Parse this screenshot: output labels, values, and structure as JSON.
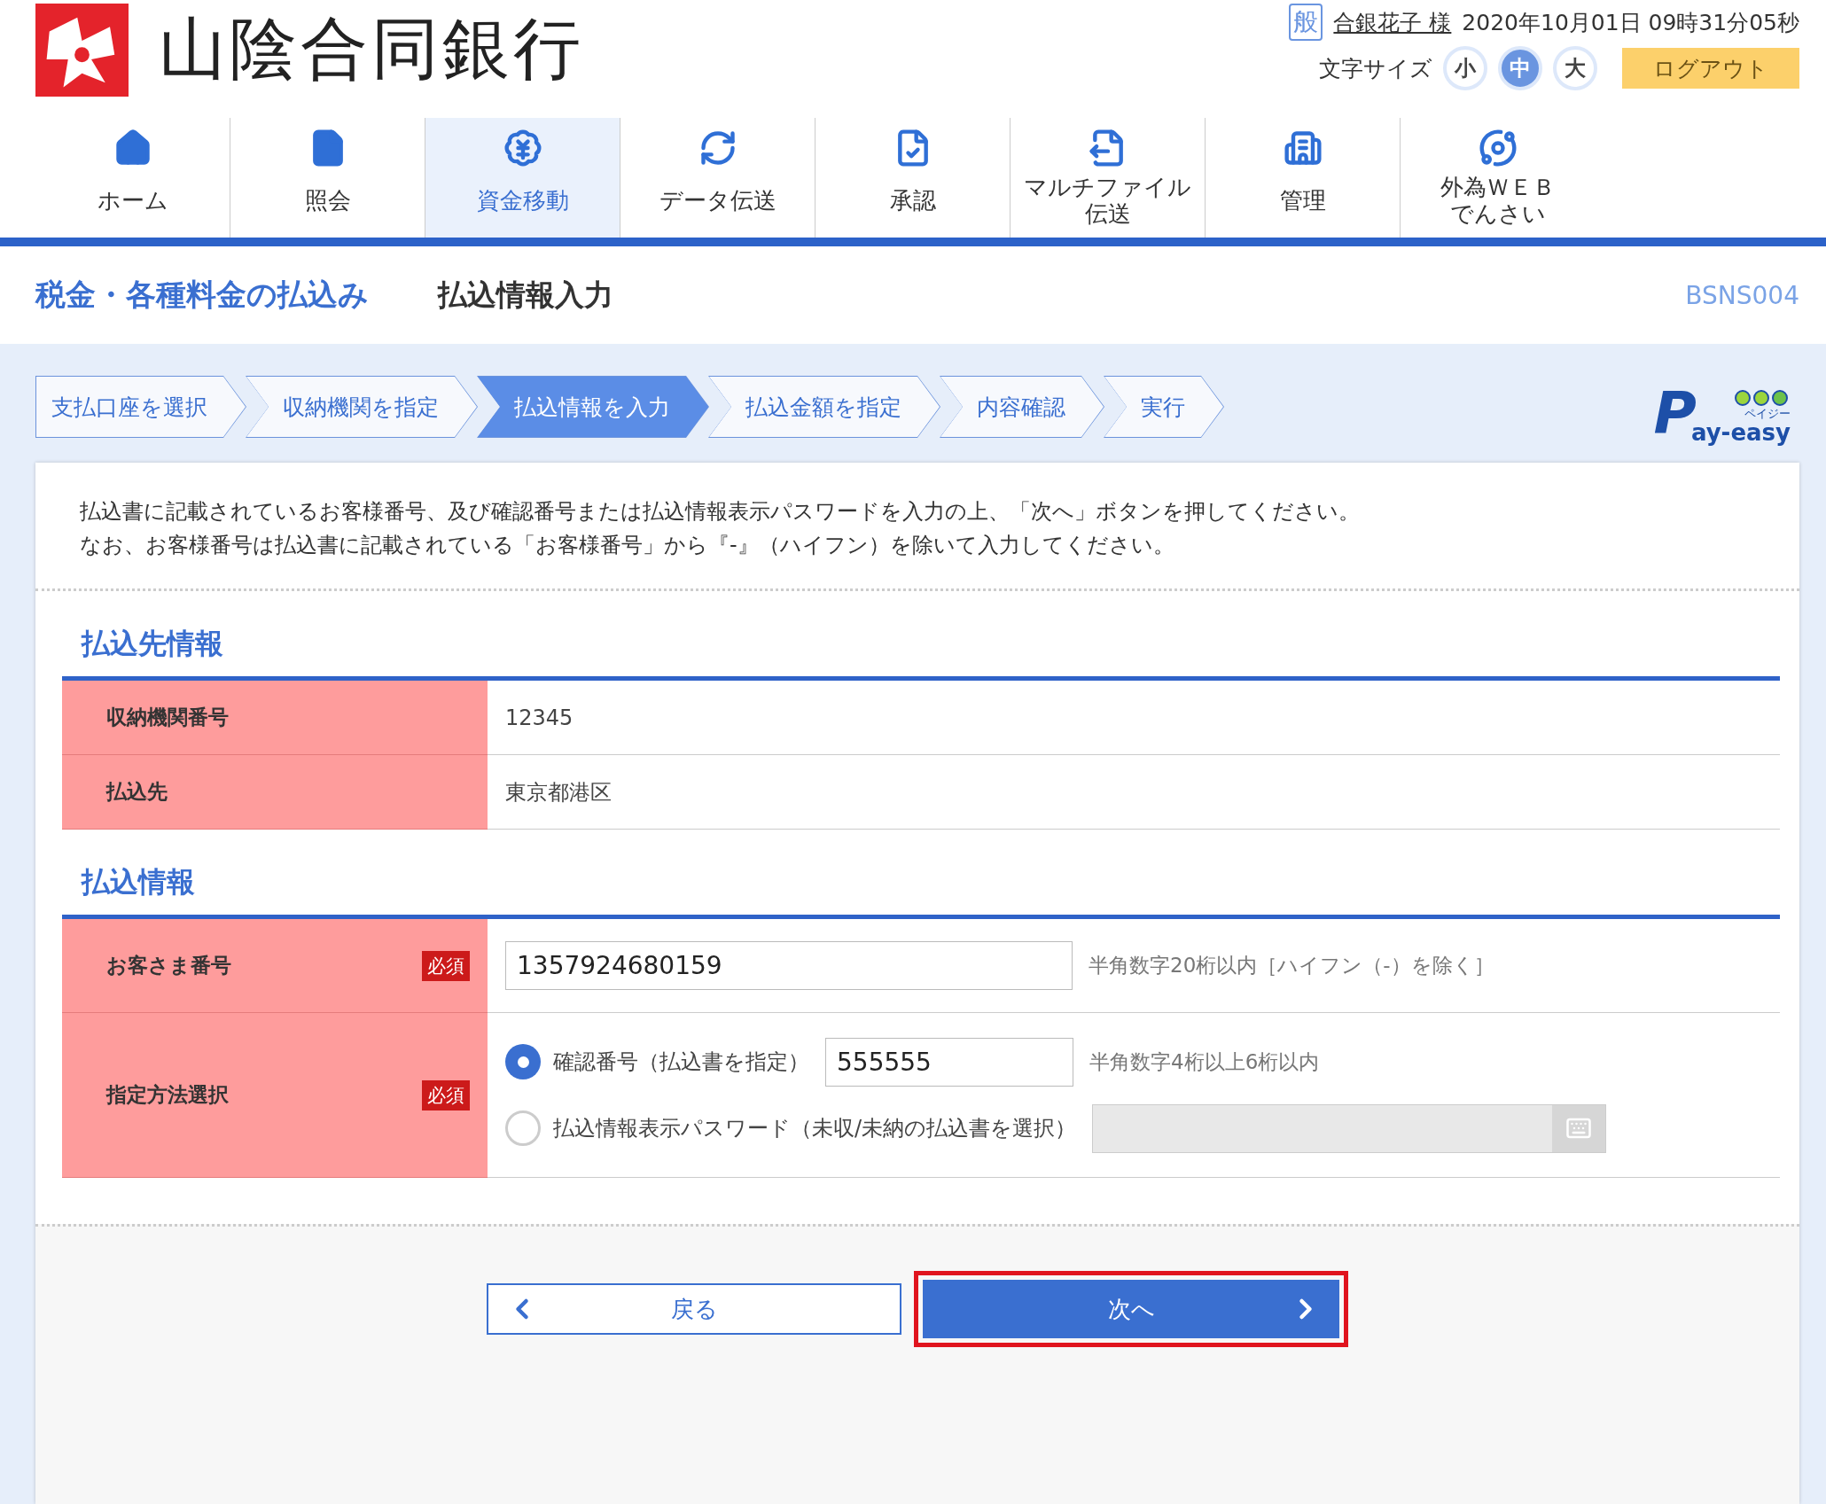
{
  "header": {
    "bank_name": "山陰合同銀行",
    "user_badge": "般",
    "user_name": "合銀花子 様",
    "datetime": "2020年10月01日 09時31分05秒",
    "font_size_label": "文字サイズ",
    "font_sizes": [
      {
        "label": "小",
        "selected": false
      },
      {
        "label": "中",
        "selected": true
      },
      {
        "label": "大",
        "selected": false
      }
    ],
    "logout": "ログアウト"
  },
  "nav": [
    {
      "lines": [
        "ホーム"
      ],
      "selected": false
    },
    {
      "lines": [
        "照会"
      ],
      "selected": false
    },
    {
      "lines": [
        "資金移動"
      ],
      "selected": true
    },
    {
      "lines": [
        "データ伝送"
      ],
      "selected": false
    },
    {
      "lines": [
        "承認"
      ],
      "selected": false
    },
    {
      "lines": [
        "マルチファイル",
        "伝送"
      ],
      "selected": false
    },
    {
      "lines": [
        "管理"
      ],
      "selected": false
    },
    {
      "lines": [
        "外為ＷＥＢ",
        "でんさい"
      ],
      "selected": false
    }
  ],
  "page": {
    "title": "税金・各種料金の払込み",
    "subtitle": "払込情報入力",
    "screen_id": "BSNS004"
  },
  "steps": [
    {
      "label": "支払口座を選択",
      "selected": false
    },
    {
      "label": "収納機関を指定",
      "selected": false
    },
    {
      "label": "払込情報を入力",
      "selected": true
    },
    {
      "label": "払込金額を指定",
      "selected": false
    },
    {
      "label": "内容確認",
      "selected": false
    },
    {
      "label": "実行",
      "selected": false
    }
  ],
  "payeasy": {
    "mark": "P",
    "text": "ay-easy",
    "kana": "ペイジー"
  },
  "intro": [
    "払込書に記載されているお客様番号、及び確認番号または払込情報表示パスワードを入力の上、「次へ」ボタンを押してください。",
    "なお、お客様番号は払込書に記載されている「お客様番号」から『-』（ハイフン）を除いて入力してください。"
  ],
  "sections": [
    {
      "heading": "払込先情報",
      "rows": [
        {
          "kind": "text",
          "label": "収納機関番号",
          "value": "12345"
        },
        {
          "kind": "text",
          "label": "払込先",
          "value": "東京都港区"
        }
      ]
    },
    {
      "heading": "払込情報",
      "rows": [
        {
          "kind": "input",
          "label": "お客さま番号",
          "required": "必須",
          "value": "1357924680159",
          "hint": "半角数字20桁以内［ハイフン（-）を除く］"
        },
        {
          "kind": "radio",
          "label": "指定方法選択",
          "required": "必須",
          "options": [
            {
              "label": "確認番号（払込書を指定）",
              "selected": true,
              "disabled": false,
              "value": "555555",
              "hint": "半角数字4桁以上6桁以内"
            },
            {
              "label": "払込情報表示パスワード（未収/未納の払込書を選択）",
              "selected": false,
              "disabled": true
            }
          ]
        }
      ]
    }
  ],
  "buttons": {
    "back": "戻る",
    "next": {
      "label": "次へ",
      "highlighted": true
    }
  }
}
